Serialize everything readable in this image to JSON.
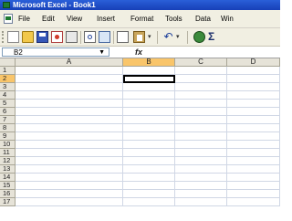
{
  "window": {
    "title": "Microsoft Excel - Book1"
  },
  "menu": [
    "File",
    "Edit",
    "View",
    "Insert",
    "Format",
    "Tools",
    "Data",
    "Win"
  ],
  "toolbar": {
    "icons": [
      "new-icon",
      "open-icon",
      "save-icon",
      "permission-icon",
      "print-icon",
      "print-preview-icon",
      "research-icon",
      "copy-icon",
      "paste-icon",
      "undo-icon",
      "hyperlink-icon",
      "autosum-icon"
    ]
  },
  "formula": {
    "name_box": "B2",
    "fx_label": "fx",
    "value": ""
  },
  "sheet": {
    "columns": [
      "A",
      "B",
      "C",
      "D"
    ],
    "rows": [
      "1",
      "2",
      "3",
      "4",
      "5",
      "6",
      "7",
      "8",
      "9",
      "10",
      "11",
      "12",
      "13",
      "14",
      "15",
      "16",
      "17"
    ],
    "active_cell": "B2",
    "selected_column": "B",
    "selected_row": "2"
  },
  "colors": {
    "titlebar": "#2a5fd8",
    "selected_header": "#f9c56a",
    "grid_line": "#d0d7e5"
  }
}
